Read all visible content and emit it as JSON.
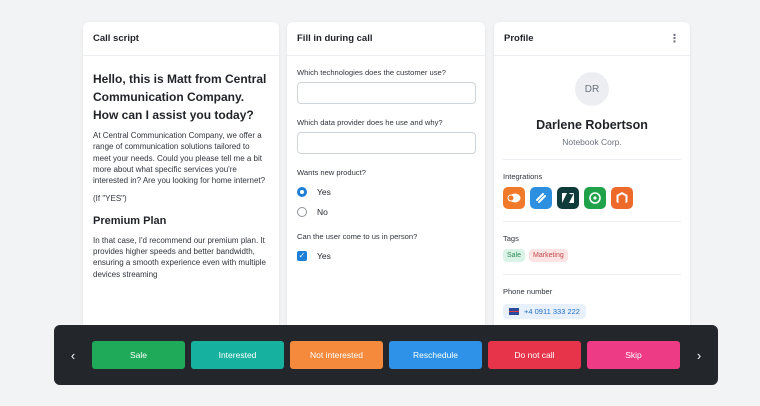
{
  "script": {
    "title": "Call script",
    "greeting": "Hello, this is Matt from Central Communication Company. How can I assist you today?",
    "paragraph": "At Central Communication Company, we offer a range of communication solutions tailored to meet your needs. Could you please tell me a bit more about what specific services you're interested in? Are you looking for home internet?",
    "if_yes": "(If \"YES\")",
    "plan_heading": "Premium Plan",
    "plan_text": "In that case, I'd recommend our premium plan. It provides higher speeds and better bandwidth, ensuring a smooth experience even with multiple devices streaming"
  },
  "fill": {
    "title": "Fill in during call",
    "q1": "Which technologies does the customer use?",
    "q2": "Which data provider does he use and why?",
    "q3": "Wants new product?",
    "q3_options": [
      "Yes",
      "No"
    ],
    "q3_selected": "Yes",
    "q4": "Can the user come to us in person?",
    "q4_option": "Yes",
    "q4_checked": true
  },
  "profile": {
    "title": "Profile",
    "initials": "DR",
    "name": "Darlene Robertson",
    "company": "Notebook Corp.",
    "integrations_label": "Integrations",
    "integrations": [
      {
        "icon": "integration-orange-bubble-icon",
        "color": "#f0792a"
      },
      {
        "icon": "integration-blue-slash-icon",
        "color": "#2d8fe0"
      },
      {
        "icon": "integration-zendesk-icon",
        "color": "#0f3b3a"
      },
      {
        "icon": "integration-green-headset-icon",
        "color": "#1fa24a"
      },
      {
        "icon": "integration-magento-icon",
        "color": "#ee6a2a"
      }
    ],
    "tags_label": "Tags",
    "tags": [
      "Sale",
      "Marketing"
    ],
    "phone_label": "Phone number",
    "phone": "+4 0911 333 222"
  },
  "actions": {
    "buttons": [
      {
        "label": "Sale",
        "color": "#1faa59"
      },
      {
        "label": "Interested",
        "color": "#17b29f"
      },
      {
        "label": "Not interested",
        "color": "#f58a3c"
      },
      {
        "label": "Reschedule",
        "color": "#2e93e8"
      },
      {
        "label": "Do not call",
        "color": "#e8344a"
      },
      {
        "label": "Skip",
        "color": "#ee3b85"
      }
    ],
    "prev_icon": "chevron-left-icon",
    "next_icon": "chevron-right-icon"
  }
}
